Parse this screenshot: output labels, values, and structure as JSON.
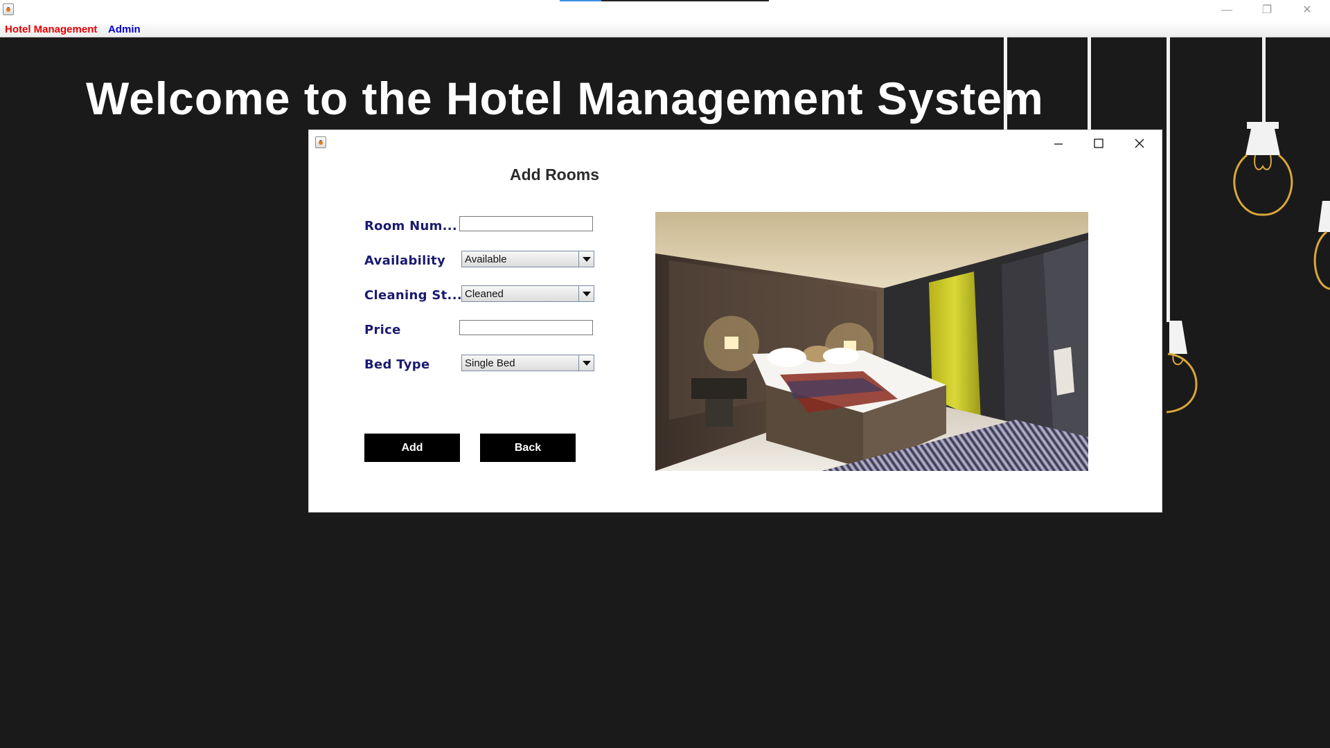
{
  "app": {
    "menus": [
      {
        "label": "Hotel Management",
        "color": "#e60000"
      },
      {
        "label": "Admin",
        "color": "#0000cc"
      }
    ],
    "window_controls": [
      "minimize-icon",
      "restore-icon",
      "close-icon"
    ]
  },
  "background": {
    "welcome_text": "Welcome to the Hotel Management System"
  },
  "dialog": {
    "title": "Add Rooms",
    "window_controls": [
      "minimize-icon",
      "maximize-icon",
      "close-icon"
    ],
    "fields": {
      "room_number": {
        "label": "Room Num...",
        "value": ""
      },
      "availability": {
        "label": "Availability",
        "value": "Available"
      },
      "cleaning_status": {
        "label": "Cleaning St...",
        "value": "Cleaned"
      },
      "price": {
        "label": "Price",
        "value": ""
      },
      "bed_type": {
        "label": "Bed Type",
        "value": "Single Bed"
      }
    },
    "buttons": {
      "add": "Add",
      "back": "Back"
    },
    "image": "hotel-bedroom-photo"
  },
  "colors": {
    "background": "#1a1a1a",
    "label_color": "#1a1a6e",
    "button_bg": "#000000"
  }
}
